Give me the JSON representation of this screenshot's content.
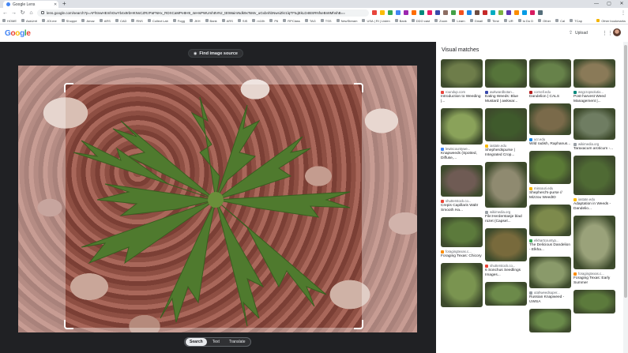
{
  "browser": {
    "tab_title": "Google Lens",
    "url": "lens.google.com/search?p=AFhtnwHEmhGwYb4x9rbHKNsCZRzPaFNHx_RDXCaMPe8H9_4eHsPWUmh8VNz_tEtWaimNdk9xTsMv_uGxbnhbNwsiZkr1lqTFtujEkLD4BSRNfseBn8MhshB==",
    "nav": {
      "back": "←",
      "forward": "→",
      "reload": "↻",
      "home": "⌂"
    },
    "window": {
      "minimize": "—",
      "maximize": "▢",
      "close": "✕"
    },
    "new_tab": "+",
    "menu": "⋮",
    "extension_colors": [
      "#e8453c",
      "#fbbc05",
      "#34a853",
      "#4285f4",
      "#9c27b0",
      "#ff6d00",
      "#00897b",
      "#e91e63",
      "#3949ab",
      "#8d6e63",
      "#43a047",
      "#f4511e",
      "#1e88e5",
      "#6d4c41",
      "#c62828",
      "#00acc1",
      "#7cb342",
      "#5e35b1",
      "#fb8c00",
      "#039be5",
      "#d81b60",
      "#546e7a"
    ],
    "bookmarks": [
      "HOME",
      "AskUnit",
      "JOI.me",
      "Shoppe",
      "Amaz",
      "ARS",
      "CAD",
      "RNS",
      "Collect Lab",
      "Fogg",
      "JKH",
      "Bank",
      "ARS",
      "SIS",
      "rx10h",
      "P6",
      "RPClass",
      "TAG",
      "TSS",
      "NewStream",
      "USA | RI | Listen",
      "Bank",
      "DDO cast",
      "Zoom",
      "Learn",
      "Gmail",
      "Time",
      "UR",
      "to Do D",
      "Other",
      "Cal",
      "TCap"
    ],
    "bookmarks_other": "Other bookmarks"
  },
  "header": {
    "logo": [
      "G",
      "o",
      "o",
      "g",
      "l",
      "e"
    ],
    "upload_icon": "upload-icon",
    "upload_label": "Upload",
    "apps_icon": "⋮⋮"
  },
  "viewer": {
    "find_source_label": "Find image source",
    "find_source_icon": "lens-icon",
    "modes": [
      "Search",
      "Text",
      "Translate"
    ],
    "active_mode": "Search"
  },
  "results": {
    "heading": "Visual matches",
    "columns": [
      [
        {
          "color": "#6e7d4a",
          "h": 36,
          "source": "roundup.com",
          "fav": "#e8453c",
          "title": "Introduction to Weeding |..."
        },
        {
          "color": "#8aa25a",
          "h": 46,
          "source": "lewiscountywe...",
          "fav": "#4285f4",
          "title": "Knapweeds (Spotted, Diffuse,..."
        },
        {
          "color": "#6f5b54",
          "h": 40,
          "source": "shutterstock.co...",
          "fav": "#ea4335",
          "title": "Crepis Capillaris Waltr Smooth Ha..."
        },
        {
          "color": "#5c7a3c",
          "h": 38,
          "source": "foragingtexas.c...",
          "fav": "#fb8c00",
          "title": "Foraging Texas: Chicory"
        },
        {
          "color": "#7a9450",
          "h": 56,
          "source": "",
          "fav": "",
          "title": ""
        }
      ],
      [
        {
          "color": "#56743a",
          "h": 36,
          "source": "awkwardbotan...",
          "fav": "#3949ab",
          "title": "Eating Weeds: Blue Mustard | awkwar..."
        },
        {
          "color": "#3f5a2c",
          "h": 42,
          "source": "iastate.edu",
          "fav": "#fbbc05",
          "title": "Shepherdspurse | Integrated Crop..."
        },
        {
          "color": "#8f8a70",
          "h": 58,
          "source": "wikimedia.org",
          "fav": "#9aa0a6",
          "title": "File:Herderstasje blad rozet (Capsel..."
        },
        {
          "color": "#786a3c",
          "h": 42,
          "source": "shutterstock.co...",
          "fav": "#ea4335",
          "title": "6 Sonchus Seedlings Images..."
        },
        {
          "color": "#6c8a4a",
          "h": 30,
          "source": "",
          "fav": "",
          "title": ""
        }
      ],
      [
        {
          "color": "#67824a",
          "h": 36,
          "source": "cornell.edu",
          "fav": "#b31b1b",
          "title": "Dandelion | CALS"
        },
        {
          "color": "#7a6a4a",
          "h": 40,
          "source": "ucr.edu",
          "fav": "#1e88e5",
          "title": "Wild radish, Raphanus..."
        },
        {
          "color": "#5b7a36",
          "h": 42,
          "source": "missouri.edu",
          "fav": "#f4b400",
          "title": "Shepherd's-purse // Mizzou WeedID"
        },
        {
          "color": "#7d8a4c",
          "h": 40,
          "source": "elkhartcountyp...",
          "fav": "#34a853",
          "title": "The Delicious Dandelion - Elkha..."
        },
        {
          "color": "#8a9a6a",
          "h": 40,
          "source": "utahweedsuper...",
          "fav": "#9aa0a6",
          "title": "Russian Knapweed - UWSA"
        },
        {
          "color": "#6a8a4a",
          "h": 30,
          "source": "",
          "fav": "",
          "title": ""
        }
      ],
      [
        {
          "color": "#8a7a58",
          "h": 36,
          "source": "wsgcropsolutio...",
          "fav": "#00897b",
          "title": "Post-harvest Weed Management |..."
        },
        {
          "color": "#6f7d62",
          "h": 40,
          "source": "wikimedia.org",
          "fav": "#9aa0a6",
          "title": "Taraxacum aroticum -..."
        },
        {
          "color": "#4f6a34",
          "h": 50,
          "source": "iastate.edu",
          "fav": "#fbbc05",
          "title": "Adaptation in Weeds - Dandelio..."
        },
        {
          "color": "#9aa27a",
          "h": 68,
          "source": "foragingtexas.c...",
          "fav": "#fb8c00",
          "title": "Foraging Texas: Early Summer"
        },
        {
          "color": "#5c7a3c",
          "h": 30,
          "source": "",
          "fav": "",
          "title": ""
        }
      ]
    ]
  }
}
